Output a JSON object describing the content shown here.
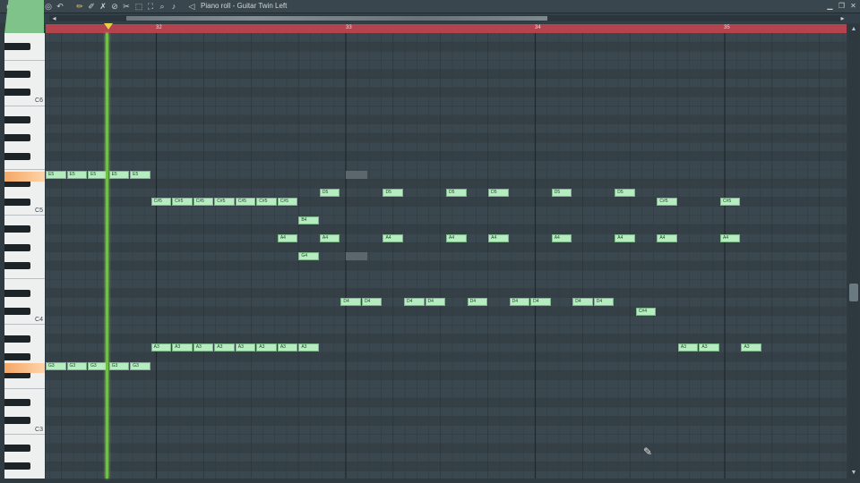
{
  "titlebar": {
    "title": "Piano roll - Guitar Twin Left",
    "icons": [
      "play-arrow-icon",
      "wrench-icon",
      "magnet-icon",
      "target-icon",
      "undo-icon",
      "pencil-icon",
      "paint-icon",
      "delete-icon",
      "mute-icon",
      "slice-icon",
      "select-icon",
      "zoom-icon",
      "speaker-icon"
    ]
  },
  "ruler": {
    "bars": [
      "32",
      "33",
      "34",
      "35"
    ]
  },
  "keyboard": {
    "labels": [
      "C6",
      "C5",
      "C4",
      "C3"
    ]
  },
  "colors": {
    "note": "#b5ecc0",
    "ruler": "#b3434d",
    "playhead": "#6fbf4a"
  },
  "notes": [
    {
      "label": "E5"
    },
    {
      "label": "E5"
    },
    {
      "label": "E5"
    },
    {
      "label": "E5"
    },
    {
      "label": "E5"
    },
    {
      "label": "G3"
    },
    {
      "label": "G3"
    },
    {
      "label": "G3"
    },
    {
      "label": "G3"
    },
    {
      "label": "G3"
    },
    {
      "label": "C#5"
    },
    {
      "label": "C#5"
    },
    {
      "label": "C#5"
    },
    {
      "label": "C#5"
    },
    {
      "label": "C#5"
    },
    {
      "label": "C#5"
    },
    {
      "label": "C#5"
    },
    {
      "label": "A3"
    },
    {
      "label": "A3"
    },
    {
      "label": "A3"
    },
    {
      "label": "A3"
    },
    {
      "label": "A3"
    },
    {
      "label": "A3"
    },
    {
      "label": "A3"
    },
    {
      "label": "A3"
    },
    {
      "label": "B4"
    },
    {
      "label": "A4"
    },
    {
      "label": "G4"
    },
    {
      "label": "D5"
    },
    {
      "label": "D5"
    },
    {
      "label": "D5"
    },
    {
      "label": "D5"
    },
    {
      "label": "D5"
    },
    {
      "label": "D5"
    },
    {
      "label": "A4"
    },
    {
      "label": "A4"
    },
    {
      "label": "A4"
    },
    {
      "label": "A4"
    },
    {
      "label": "A4"
    },
    {
      "label": "A4"
    },
    {
      "label": "A4"
    },
    {
      "label": "C#5"
    },
    {
      "label": "C#5"
    },
    {
      "label": "A4"
    },
    {
      "label": "A4"
    },
    {
      "label": "D4"
    },
    {
      "label": "D4"
    },
    {
      "label": "D4"
    },
    {
      "label": "D4"
    },
    {
      "label": "D4"
    },
    {
      "label": "D4"
    },
    {
      "label": "D4"
    },
    {
      "label": "D4"
    },
    {
      "label": "D4"
    },
    {
      "label": "C#4"
    },
    {
      "label": "A3"
    },
    {
      "label": "A3"
    },
    {
      "label": "A3"
    }
  ]
}
